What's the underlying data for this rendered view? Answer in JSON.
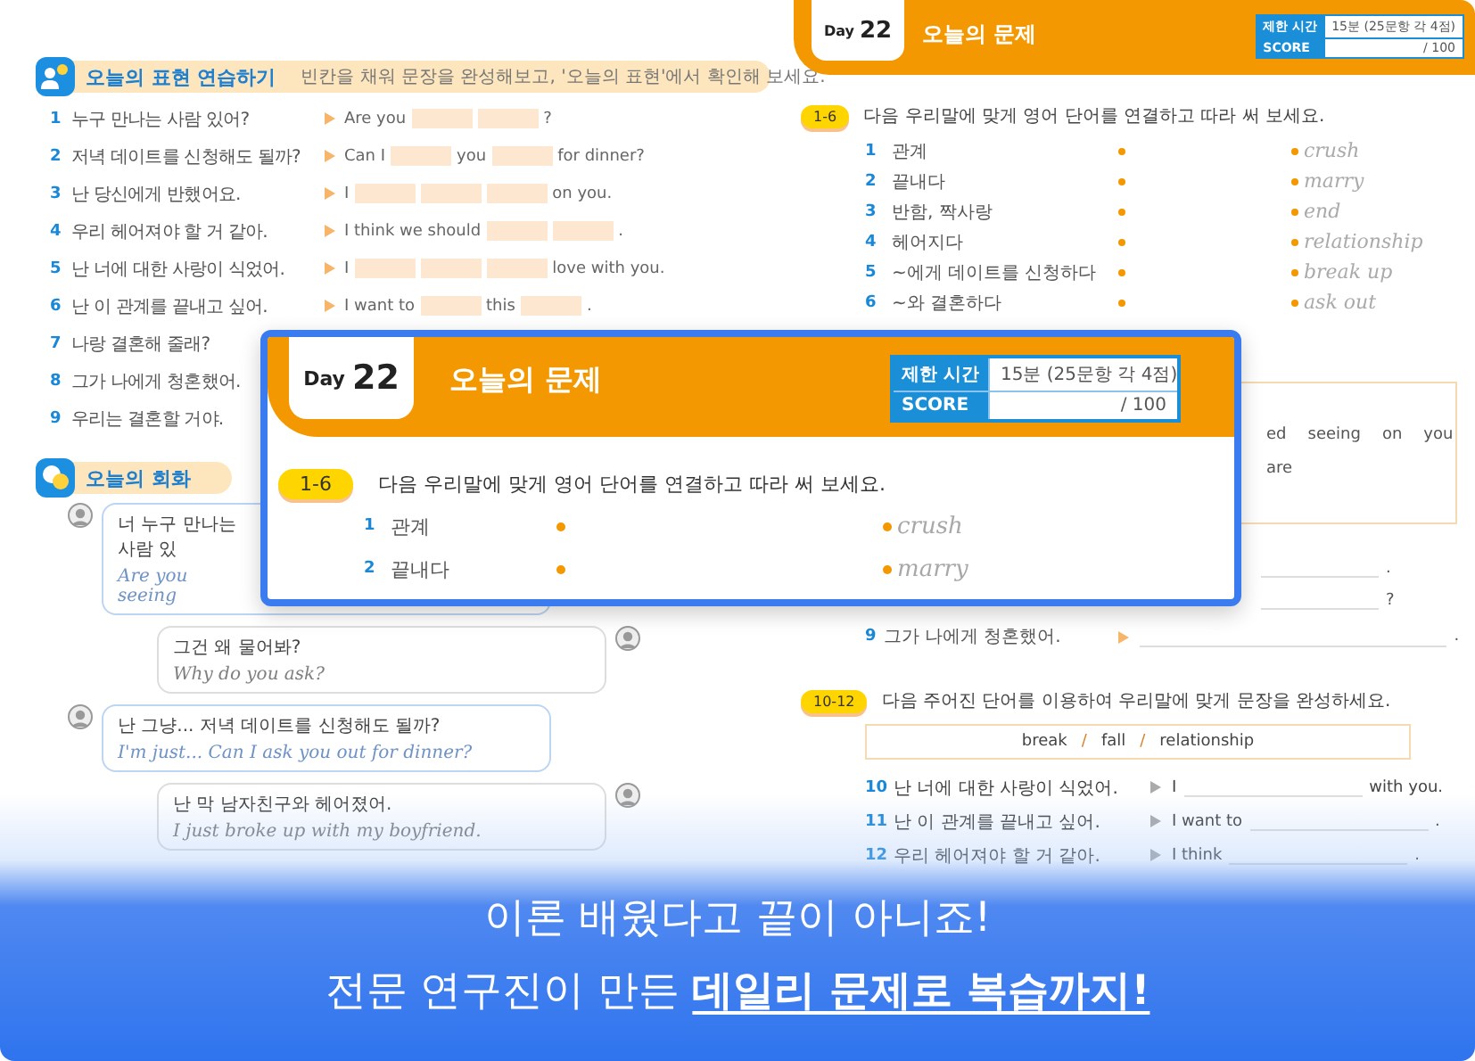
{
  "practice": {
    "title": "오늘의 표현 연습하기",
    "subtitle": "빈칸을 채워 문장을 완성해보고, '오늘의 표현'에서 확인해 보세요.",
    "items": [
      {
        "number": "1",
        "korean": "누구 만나는 사람 있어?",
        "segments": [
          {
            "kind": "text",
            "text": "Are you"
          },
          {
            "kind": "blank"
          },
          {
            "kind": "blank"
          },
          {
            "kind": "text",
            "text": "?"
          }
        ]
      },
      {
        "number": "2",
        "korean": "저녁 데이트를 신청해도 될까?",
        "segments": [
          {
            "kind": "text",
            "text": "Can I"
          },
          {
            "kind": "blank"
          },
          {
            "kind": "text",
            "text": "you"
          },
          {
            "kind": "blank"
          },
          {
            "kind": "text",
            "text": "for dinner?"
          }
        ]
      },
      {
        "number": "3",
        "korean": "난 당신에게 반했어요.",
        "segments": [
          {
            "kind": "text",
            "text": "I"
          },
          {
            "kind": "blank"
          },
          {
            "kind": "blank"
          },
          {
            "kind": "blank"
          },
          {
            "kind": "text",
            "text": "on you."
          }
        ]
      },
      {
        "number": "4",
        "korean": "우리 헤어져야 할 거 같아.",
        "segments": [
          {
            "kind": "text",
            "text": "I think we should"
          },
          {
            "kind": "blank"
          },
          {
            "kind": "blank"
          },
          {
            "kind": "text",
            "text": "."
          }
        ]
      },
      {
        "number": "5",
        "korean": "난 너에 대한 사랑이 식었어.",
        "segments": [
          {
            "kind": "text",
            "text": "I"
          },
          {
            "kind": "blank"
          },
          {
            "kind": "blank"
          },
          {
            "kind": "blank"
          },
          {
            "kind": "text",
            "text": "love with you."
          }
        ]
      },
      {
        "number": "6",
        "korean": "난 이 관계를 끝내고 싶어.",
        "segments": [
          {
            "kind": "text",
            "text": "I want to"
          },
          {
            "kind": "blank"
          },
          {
            "kind": "text",
            "text": "this"
          },
          {
            "kind": "blank"
          },
          {
            "kind": "text",
            "text": "."
          }
        ]
      },
      {
        "number": "7",
        "korean": "나랑 결혼해 줄래?"
      },
      {
        "number": "8",
        "korean": "그가 나에게 청혼했어."
      },
      {
        "number": "9",
        "korean": "우리는 결혼할 거야."
      }
    ]
  },
  "conversation": {
    "title": "오늘의 회화",
    "bubbles": [
      {
        "kind": "left",
        "korean": "너 누구 만나는 사람 있",
        "english": "Are you seeing"
      },
      {
        "kind": "right",
        "korean": "그건 왜 물어봐?",
        "english": "Why do you ask?"
      },
      {
        "kind": "left",
        "korean": "난 그냥... 저녁 데이트를 신청해도 될까?",
        "english": "I'm just... Can I ask you out for dinner?"
      },
      {
        "kind": "right",
        "korean": "난 막 남자친구와 헤어졌어.",
        "english": "I just broke up with my boyfriend."
      }
    ]
  },
  "quiz": {
    "day_label": "Day",
    "day_number": "22",
    "title": "오늘의 문제",
    "time_label": "제한 시간",
    "time_value": "15분 (25문항 각 4점)",
    "score_label": "SCORE",
    "score_value": "/ 100",
    "match": {
      "badge": "1-6",
      "instruction": "다음 우리말에 맞게 영어 단어를 연결하고 따라 써 보세요.",
      "rows": [
        {
          "number": "1",
          "korean": "관계",
          "english": "crush"
        },
        {
          "number": "2",
          "korean": "끝내다",
          "english": "marry"
        },
        {
          "number": "3",
          "korean": "반함, 짝사랑",
          "english": "end"
        },
        {
          "number": "4",
          "korean": "헤어지다",
          "english": "relationship"
        },
        {
          "number": "5",
          "korean": "~에게 데이트를 신청하다",
          "english": "break up"
        },
        {
          "number": "6",
          "korean": "~와 결혼하다",
          "english": "ask out"
        }
      ]
    },
    "word_box": {
      "lines": [
        [
          "ed",
          "seeing",
          "on",
          "you"
        ],
        [
          "are"
        ]
      ]
    },
    "answers": [
      {
        "end": "."
      },
      {
        "end": "?"
      },
      {
        "number": "9",
        "korean": "그가 나에게 청혼했어.",
        "end": "."
      }
    ],
    "complete": {
      "badge": "10-12",
      "instruction": "다음 주어진 단어를 이용하여 우리말에 맞게 문장을 완성하세요.",
      "words": [
        {
          "text": "break"
        },
        {
          "separator": "/",
          "text": "fall"
        },
        {
          "separator": "/",
          "text": "relationship"
        }
      ],
      "rows": [
        {
          "number": "10",
          "korean": "난 너에 대한 사랑이 식었어.",
          "start": "I",
          "end": "with you."
        },
        {
          "number": "11",
          "korean": "난 이 관계를 끝내고 싶어.",
          "start": "I want to",
          "end": "."
        },
        {
          "number": "12",
          "korean": "우리 헤어져야 할 거 같아.",
          "start": "I think",
          "end": "."
        }
      ]
    }
  },
  "zoom_panel": {
    "day_label": "Day",
    "day_number": "22",
    "title": "오늘의 문제",
    "time_label": "제한 시간",
    "time_value": "15분 (25문항 각 4점)",
    "score_label": "SCORE",
    "score_value": "/ 100",
    "badge": "1-6",
    "instruction": "다음 우리말에 맞게 영어 단어를 연결하고 따라 써 보세요.",
    "rows": [
      {
        "number": "1",
        "korean": "관계",
        "english": "crush"
      },
      {
        "number": "2",
        "korean": "끝내다",
        "english": "marry"
      }
    ]
  },
  "banner": {
    "headline": "이론 배웠다고 끝이 아니죠!",
    "subheadline": "전문 연구진이 만든 **데일리 문제로 복습까지!**"
  }
}
